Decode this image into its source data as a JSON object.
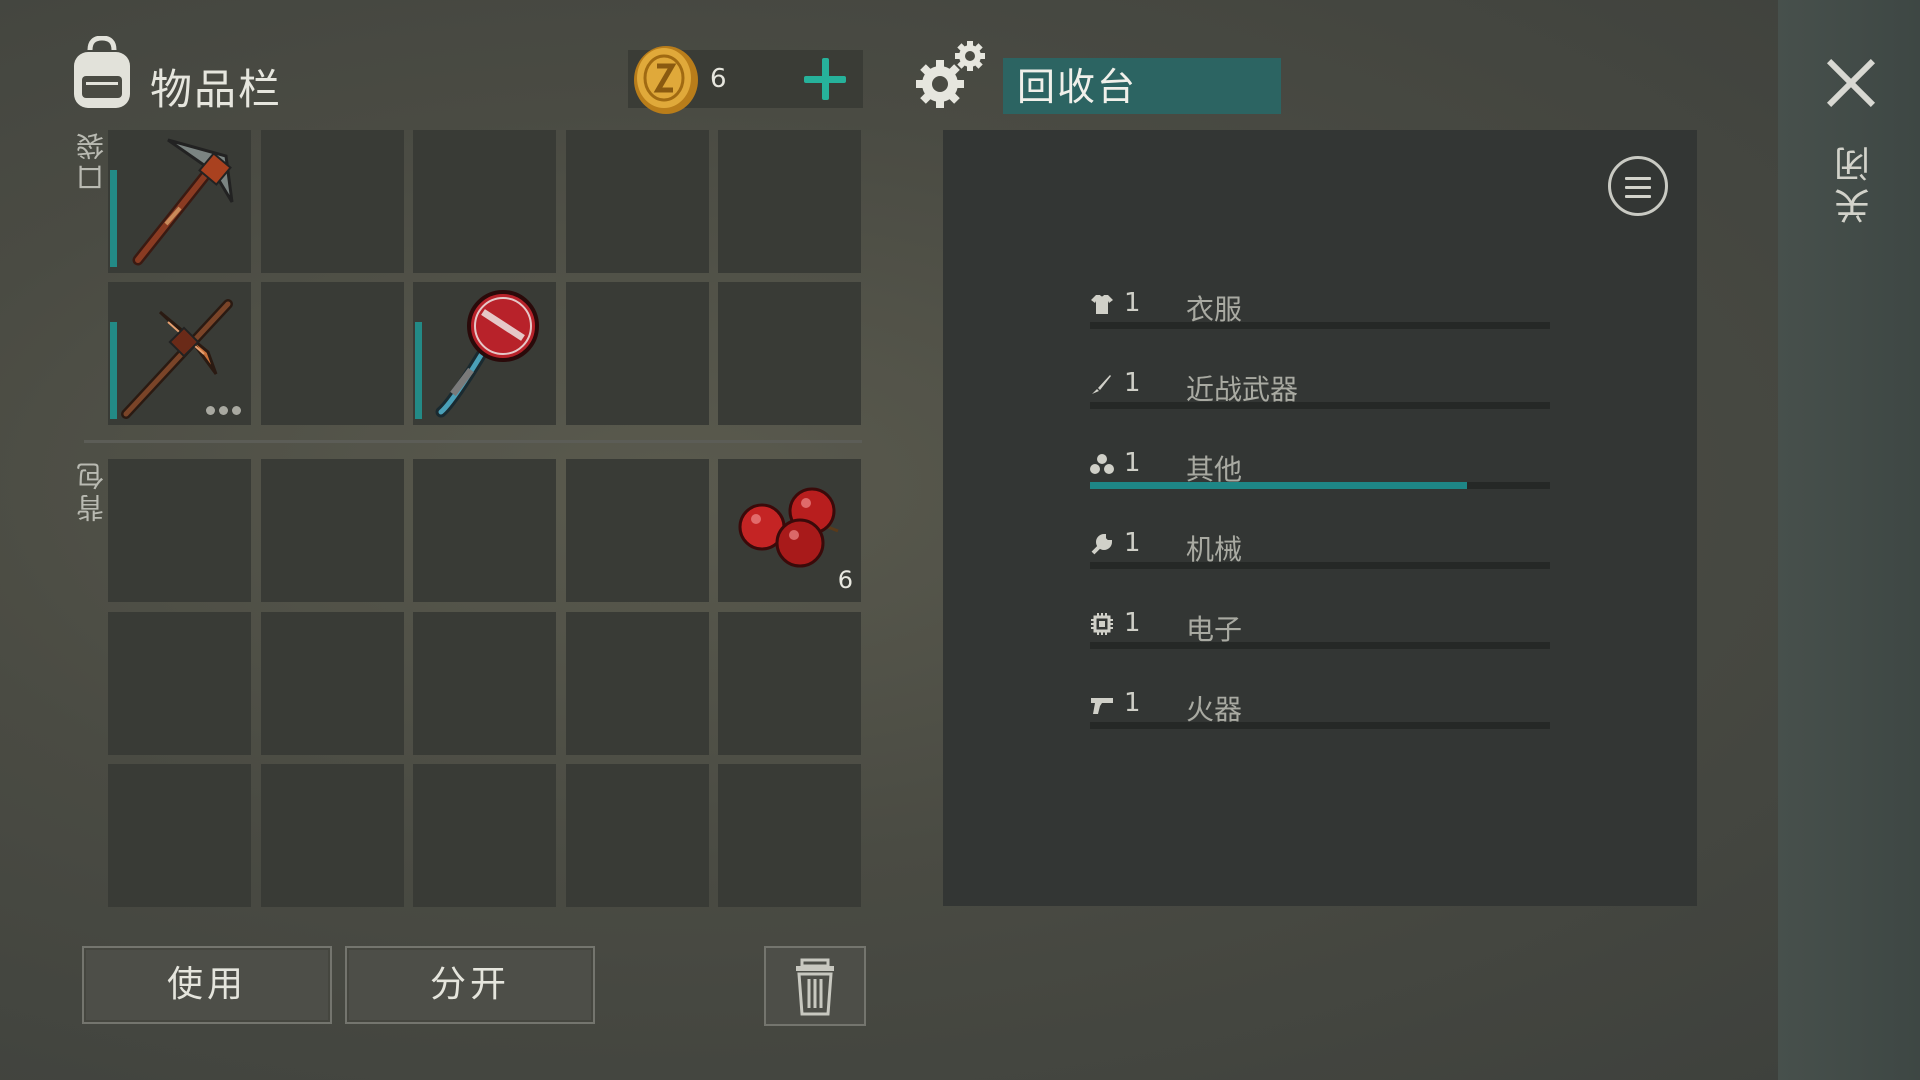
{
  "inventory": {
    "title": "物品栏",
    "coins": "6",
    "pocket_label": "口袋",
    "backpack_label": "背包",
    "pocket_slots": [
      {
        "item": "pickaxe-icon",
        "count": ""
      },
      {
        "item": "",
        "count": ""
      },
      {
        "item": "",
        "count": ""
      },
      {
        "item": "",
        "count": ""
      },
      {
        "item": "",
        "count": ""
      },
      {
        "item": "crude-pickaxe-icon",
        "count": ""
      },
      {
        "item": "",
        "count": ""
      },
      {
        "item": "stop-sign-axe-icon",
        "count": ""
      },
      {
        "item": "",
        "count": ""
      },
      {
        "item": "",
        "count": ""
      }
    ],
    "backpack_slots": [
      {
        "item": "",
        "count": ""
      },
      {
        "item": "",
        "count": ""
      },
      {
        "item": "",
        "count": ""
      },
      {
        "item": "",
        "count": ""
      },
      {
        "item": "berries-icon",
        "count": "6"
      }
    ]
  },
  "buttons": {
    "use": "使用",
    "split": "分开"
  },
  "recycler": {
    "title": "回收台",
    "categories": [
      {
        "icon": "shirt-icon",
        "count": "1",
        "label": "衣服",
        "progress": 0
      },
      {
        "icon": "knife-icon",
        "count": "1",
        "label": "近战武器",
        "progress": 0
      },
      {
        "icon": "other-icon",
        "count": "1",
        "label": "其他",
        "progress": 0.82
      },
      {
        "icon": "wrench-icon",
        "count": "1",
        "label": "机械",
        "progress": 0
      },
      {
        "icon": "chip-icon",
        "count": "1",
        "label": "电子",
        "progress": 0
      },
      {
        "icon": "pistol-icon",
        "count": "1",
        "label": "火器",
        "progress": 0
      }
    ]
  },
  "close_label": "关闭",
  "colors": {
    "accent": "#26b29b",
    "title_bg": "#2c6462",
    "progress_fill": "#1e8686"
  }
}
